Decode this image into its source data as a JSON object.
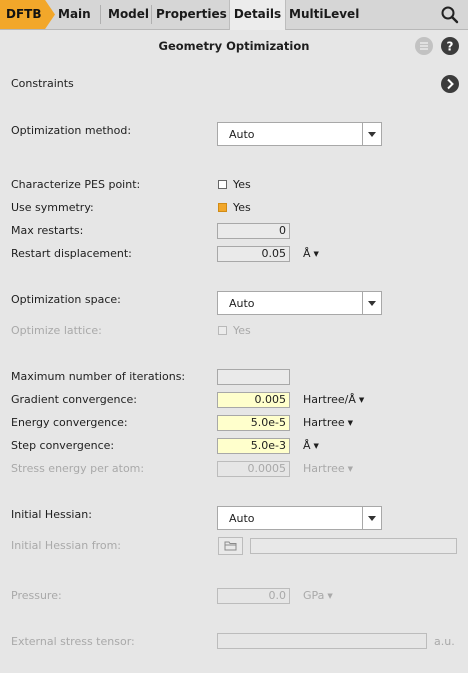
{
  "tabs": [
    {
      "label": "DFTB"
    },
    {
      "label": "Main"
    },
    {
      "label": "Model"
    },
    {
      "label": "Properties"
    },
    {
      "label": "Details"
    },
    {
      "label": "MultiLevel"
    }
  ],
  "header": {
    "title": "Geometry Optimization"
  },
  "constraints": {
    "label": "Constraints"
  },
  "optimization": {
    "method_label": "Optimization method:",
    "method_value": "Auto",
    "characterize_label": "Characterize PES point:",
    "characterize_option": "Yes",
    "characterize_checked": false,
    "symmetry_label": "Use symmetry:",
    "symmetry_option": "Yes",
    "symmetry_checked": true,
    "max_restarts_label": "Max restarts:",
    "max_restarts_value": "0",
    "restart_disp_label": "Restart displacement:",
    "restart_disp_value": "0.05",
    "restart_disp_unit": "Å",
    "space_label": "Optimization space:",
    "space_value": "Auto",
    "lattice_label": "Optimize lattice:",
    "lattice_option": "Yes"
  },
  "convergence": {
    "max_iter_label": "Maximum number of iterations:",
    "max_iter_value": "",
    "gradient_label": "Gradient convergence:",
    "gradient_value": "0.005",
    "gradient_unit": "Hartree/Å",
    "energy_label": "Energy convergence:",
    "energy_value": "5.0e-5",
    "energy_unit": "Hartree",
    "step_label": "Step convergence:",
    "step_value": "5.0e-3",
    "step_unit": "Å",
    "stress_label": "Stress energy per atom:",
    "stress_value": "0.0005",
    "stress_unit": "Hartree"
  },
  "hessian": {
    "label": "Initial Hessian:",
    "value": "Auto",
    "from_label": "Initial Hessian from:",
    "from_value": ""
  },
  "pressure": {
    "label": "Pressure:",
    "value": "0.0",
    "unit": "GPa"
  },
  "stress_tensor": {
    "label": "External stress tensor:",
    "value": "",
    "unit": "a.u."
  },
  "colors": {
    "accent": "#f2a72a",
    "highlight_input": "#ffffcc"
  }
}
